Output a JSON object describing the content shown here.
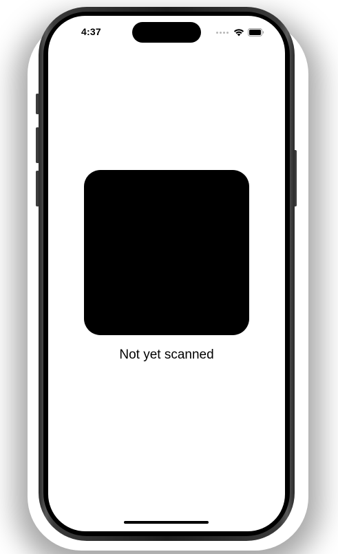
{
  "status_bar": {
    "time": "4:37",
    "icons": [
      "cellular-dots-icon",
      "wifi-icon",
      "battery-icon"
    ]
  },
  "scanner": {
    "preview_icon": "camera-preview",
    "status_text": "Not yet scanned"
  },
  "colors": {
    "background": "#ffffff",
    "preview": "#000000",
    "text": "#000000"
  }
}
